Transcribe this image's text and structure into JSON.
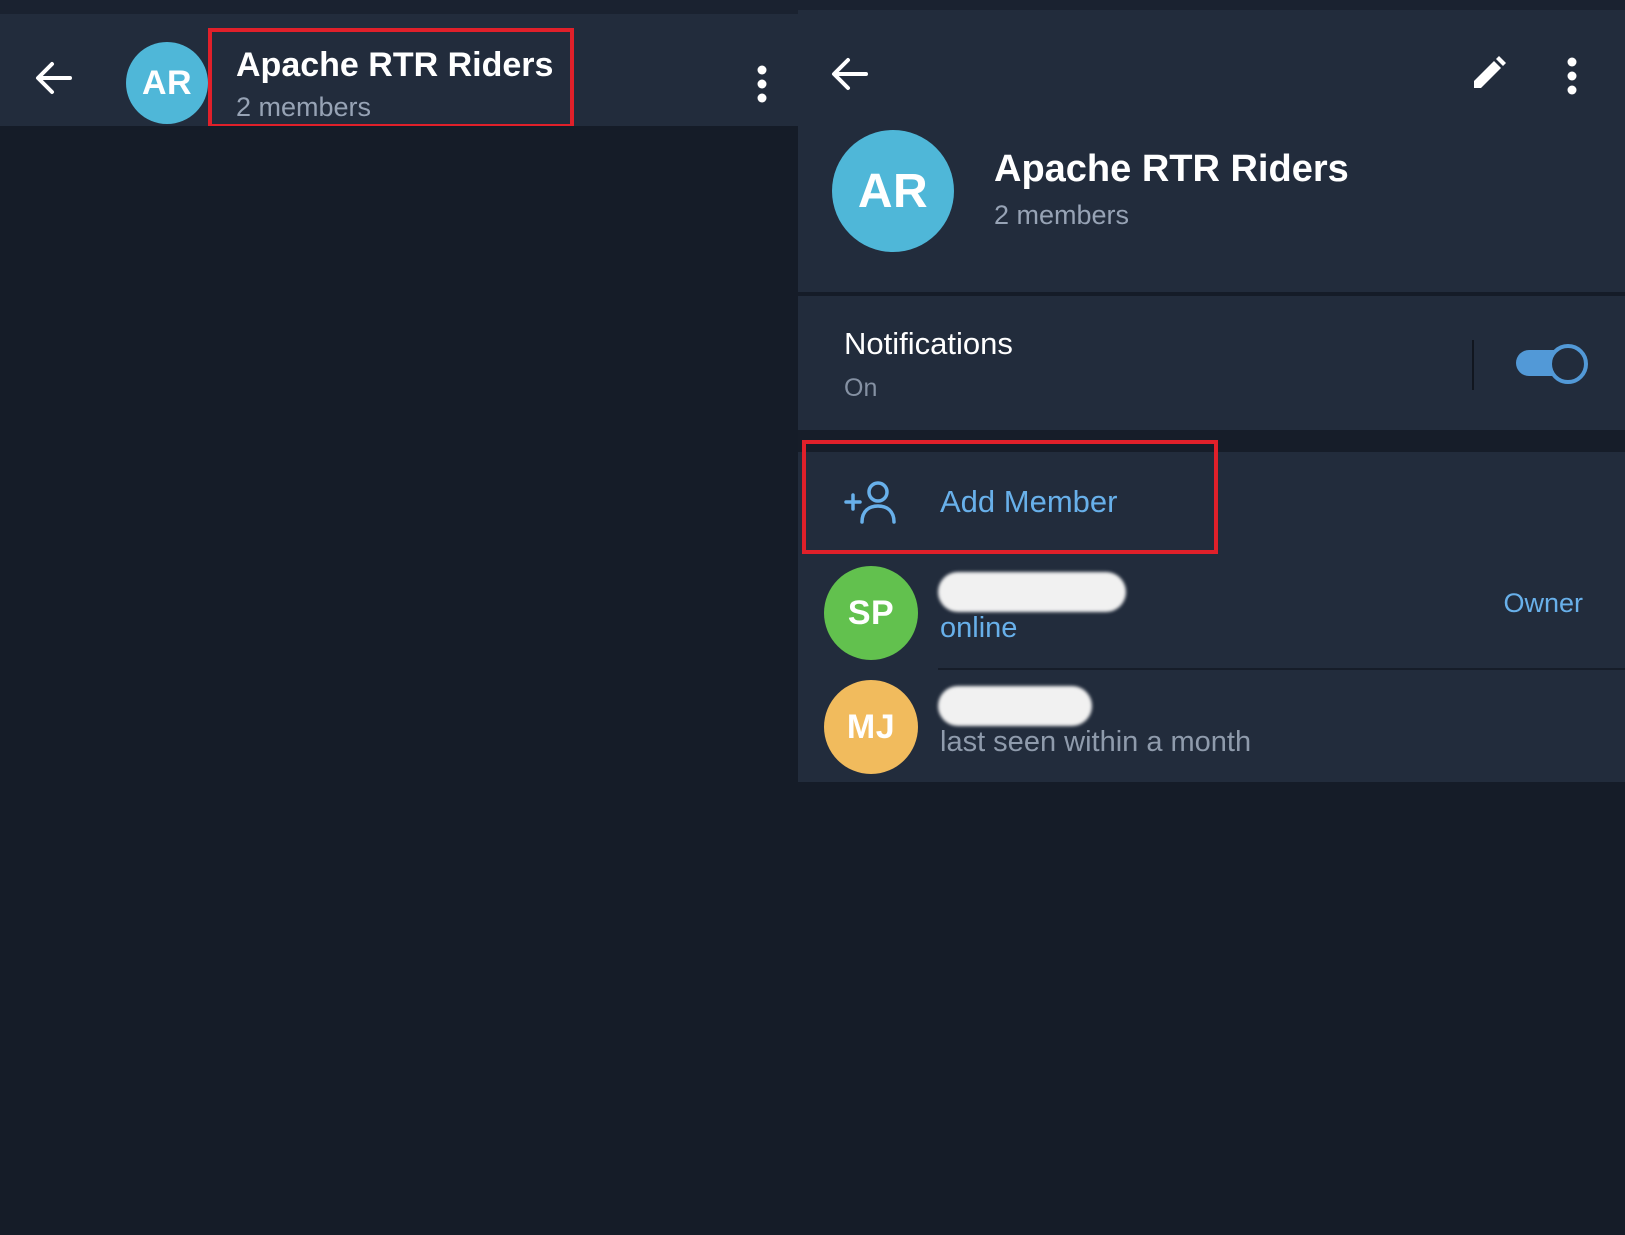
{
  "colors": {
    "background": "#151c28",
    "header_bg": "#222c3c",
    "accent": "#68b0ea",
    "highlight_box": "#e0202a",
    "avatar_ar": "#4fb7d8",
    "avatar_sp": "#62c14e",
    "avatar_mj": "#f1bb5d"
  },
  "chat_screen": {
    "header": {
      "back_icon": "arrow-left-icon",
      "avatar_initials": "AR",
      "title": "Apache RTR Riders",
      "subtitle": "2 members",
      "menu_icon": "more-vertical-icon"
    }
  },
  "info_screen": {
    "toolbar": {
      "back_icon": "arrow-left-icon",
      "edit_icon": "pencil-icon",
      "menu_icon": "more-vertical-icon"
    },
    "group": {
      "avatar_initials": "AR",
      "name": "Apache RTR Riders",
      "members_count": "2 members"
    },
    "notifications": {
      "label": "Notifications",
      "status": "On",
      "enabled": true
    },
    "add_member": {
      "icon": "add-person-icon",
      "label": "Add Member"
    },
    "members": [
      {
        "initials": "SP",
        "name": "",
        "status": "online",
        "role": "Owner"
      },
      {
        "initials": "MJ",
        "name": "",
        "status": "last seen within a month",
        "role": ""
      }
    ]
  }
}
